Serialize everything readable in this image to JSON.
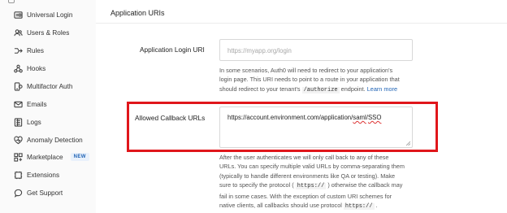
{
  "sidebar": {
    "items": [
      {
        "label": "Universal Login",
        "icon": "universal-login-icon"
      },
      {
        "label": "Users & Roles",
        "icon": "users-icon"
      },
      {
        "label": "Rules",
        "icon": "rules-icon"
      },
      {
        "label": "Hooks",
        "icon": "hooks-icon"
      },
      {
        "label": "Multifactor Auth",
        "icon": "multifactor-icon"
      },
      {
        "label": "Emails",
        "icon": "email-icon"
      },
      {
        "label": "Logs",
        "icon": "logs-icon"
      },
      {
        "label": "Anomaly Detection",
        "icon": "heart-icon"
      },
      {
        "label": "Marketplace",
        "icon": "marketplace-icon",
        "badge": "NEW"
      },
      {
        "label": "Extensions",
        "icon": "extensions-icon"
      },
      {
        "label": "Get Support",
        "icon": "support-icon"
      }
    ]
  },
  "main": {
    "section_title": "Application URIs",
    "login_uri": {
      "label": "Application Login URI",
      "placeholder": "https://myapp.org/login",
      "help_line1": "In some scenarios, Auth0 will need to redirect to your application's",
      "help_line2": "login page. This URI needs to point to a route in your application that",
      "help_line3_pre": "should redirect to your tenant's",
      "help_line3_code": "/authorize",
      "help_line3_post": "endpoint.",
      "help_link": "Learn more"
    },
    "callback": {
      "label": "Allowed Callback URLs",
      "value_pre": "https://account.environment.com/application/",
      "value_saml": "saml",
      "value_mid": "/",
      "value_sso": "SSO",
      "help_line1": "After the user authenticates we will only call back to any of these",
      "help_line2": "URLs. You can specify multiple valid URLs by comma-separating them",
      "help_line3": "(typically to handle different environments like QA or testing). Make",
      "help_line4_pre": "sure to specify the protocol (",
      "help_line4_code": "https://",
      "help_line4_post": ") otherwise the callback may",
      "help_line5": "fail in some cases. With the exception of custom URI schemes for",
      "help_line6_pre": "native clients, all callbacks should use protocol",
      "help_line6_code": "https://",
      "help_line6_post": "."
    }
  },
  "colors": {
    "highlight": "#e0161b",
    "link": "#1f63b5",
    "badge_bg": "#e9f1fb"
  }
}
